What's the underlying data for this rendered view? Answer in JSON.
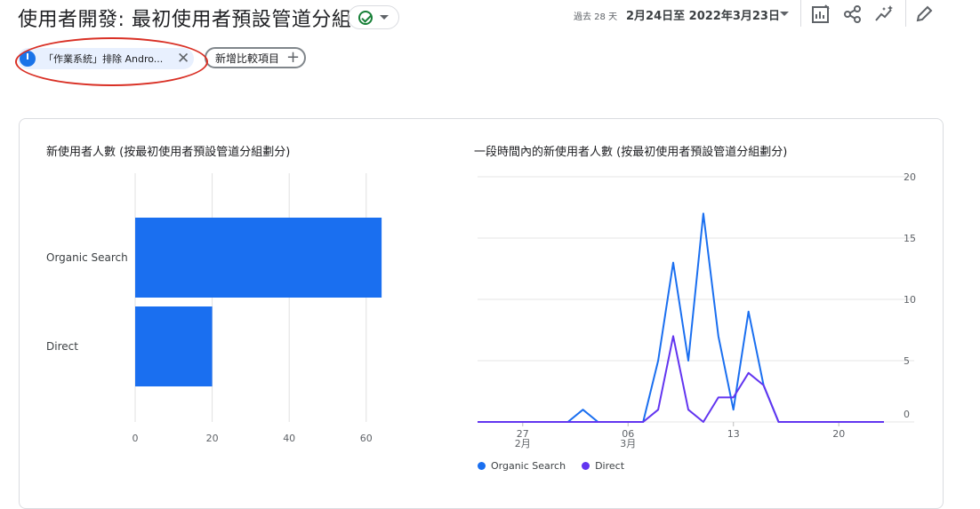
{
  "header": {
    "title": "使用者開發: 最初使用者預設管道分組",
    "date_prefix": "過去 28 天",
    "date_range": "2月24日至 2022年3月23日"
  },
  "toolbar": {
    "icons": [
      "customize-report-icon",
      "share-icon",
      "insights-icon",
      "edit-icon"
    ]
  },
  "comparisons": {
    "active_chip": "「作業系統」排除 Andro...",
    "add_label": "新增比較項目"
  },
  "colors": {
    "organic": "#1a6ff0",
    "direct": "#6235f0",
    "bar": "#1a6ff0",
    "highlight": "#d93025"
  },
  "bar_chart": {
    "title": "新使用者人數 (按最初使用者預設管道分組劃分)",
    "chart_data": {
      "type": "bar",
      "orientation": "horizontal",
      "categories": [
        "Organic Search",
        "Direct"
      ],
      "values": [
        64,
        20
      ],
      "xlim": [
        0,
        66
      ],
      "xticks": [
        "0",
        "20",
        "40",
        "60"
      ],
      "grid": true
    }
  },
  "line_chart": {
    "title": "一段時間內的新使用者人數 (按最初使用者預設管道分組劃分)",
    "chart_data": {
      "type": "line",
      "x": [
        "2/24",
        "2/25",
        "2/26",
        "2/27",
        "2/28",
        "3/1",
        "3/2",
        "3/3",
        "3/4",
        "3/5",
        "3/6",
        "3/7",
        "3/8",
        "3/9",
        "3/10",
        "3/11",
        "3/12",
        "3/13",
        "3/14",
        "3/15",
        "3/16",
        "3/17",
        "3/18",
        "3/19",
        "3/20",
        "3/21",
        "3/22",
        "3/23"
      ],
      "x_tick_labels": [
        {
          "day": "27",
          "month": "2月"
        },
        {
          "day": "06",
          "month": "3月"
        },
        {
          "day": "13",
          "month": ""
        },
        {
          "day": "20",
          "month": ""
        }
      ],
      "series": [
        {
          "name": "Organic Search",
          "values": [
            0,
            0,
            0,
            0,
            0,
            0,
            0,
            1,
            0,
            0,
            0,
            0,
            5,
            13,
            5,
            17,
            7,
            1,
            9,
            3,
            0,
            0,
            0,
            0,
            0,
            0,
            0,
            0
          ]
        },
        {
          "name": "Direct",
          "values": [
            0,
            0,
            0,
            0,
            0,
            0,
            0,
            0,
            0,
            0,
            0,
            0,
            1,
            7,
            1,
            0,
            2,
            2,
            4,
            3,
            0,
            0,
            0,
            0,
            0,
            0,
            0,
            0
          ]
        }
      ],
      "ylim": [
        0,
        20
      ],
      "yticks": [
        "0",
        "5",
        "10",
        "15",
        "20"
      ],
      "y_axis_position": "right",
      "grid": true,
      "legend_position": "bottom-left"
    }
  }
}
